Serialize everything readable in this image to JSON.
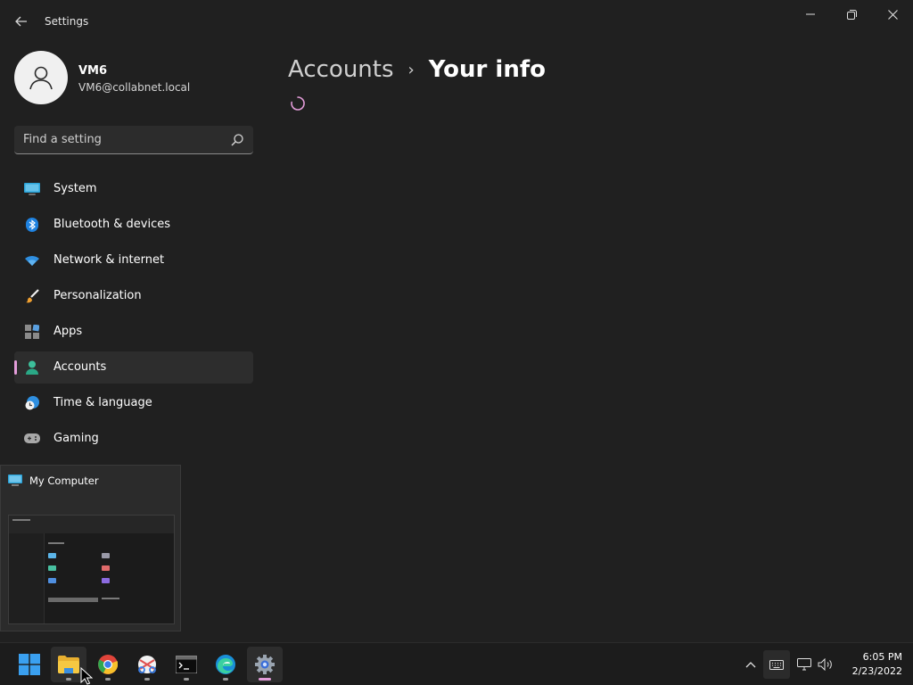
{
  "window": {
    "title": "Settings",
    "back_icon": "back-arrow-icon",
    "minimize_icon": "minimize-icon",
    "restore_icon": "restore-icon",
    "close_icon": "close-icon"
  },
  "profile": {
    "name": "VM6",
    "email": "VM6@collabnet.local",
    "avatar_icon": "user-avatar-icon"
  },
  "search": {
    "placeholder": "Find a setting",
    "value": "",
    "icon": "search-icon"
  },
  "sidebar": {
    "items": [
      {
        "label": "System",
        "icon": "monitor-icon",
        "selected": false
      },
      {
        "label": "Bluetooth & devices",
        "icon": "bluetooth-icon",
        "selected": false
      },
      {
        "label": "Network & internet",
        "icon": "wifi-icon",
        "selected": false
      },
      {
        "label": "Personalization",
        "icon": "paintbrush-icon",
        "selected": false
      },
      {
        "label": "Apps",
        "icon": "apps-icon",
        "selected": false
      },
      {
        "label": "Accounts",
        "icon": "person-icon",
        "selected": true
      },
      {
        "label": "Time & language",
        "icon": "globe-clock-icon",
        "selected": false
      },
      {
        "label": "Gaming",
        "icon": "gamepad-icon",
        "selected": false
      }
    ]
  },
  "main": {
    "breadcrumb": {
      "parent": "Accounts",
      "separator": "›",
      "current": "Your info"
    },
    "loading": true
  },
  "taskbar_preview": {
    "title": "My Computer",
    "icon": "computer-icon"
  },
  "taskbar": {
    "apps": [
      {
        "name": "start",
        "icon": "windows-start-icon",
        "running": false,
        "active": false
      },
      {
        "name": "file-explorer",
        "icon": "folder-icon",
        "running": true,
        "active": false
      },
      {
        "name": "chrome",
        "icon": "chrome-icon",
        "running": true,
        "active": false
      },
      {
        "name": "snipping-tool",
        "icon": "scissors-icon",
        "running": true,
        "active": false
      },
      {
        "name": "terminal",
        "icon": "terminal-icon",
        "running": true,
        "active": false
      },
      {
        "name": "edge",
        "icon": "edge-icon",
        "running": true,
        "active": false
      },
      {
        "name": "settings",
        "icon": "gear-icon",
        "running": true,
        "active": true
      }
    ],
    "tray": {
      "overflow_icon": "chevron-up-icon",
      "keyboard_icon": "keyboard-icon",
      "network_icon": "network-icon",
      "volume_icon": "speaker-icon"
    },
    "clock": {
      "time": "6:05 PM",
      "date": "2/23/2022"
    }
  },
  "colors": {
    "background": "#202020",
    "accent": "#e39cd9",
    "taskbar": "#1c1c1c"
  }
}
